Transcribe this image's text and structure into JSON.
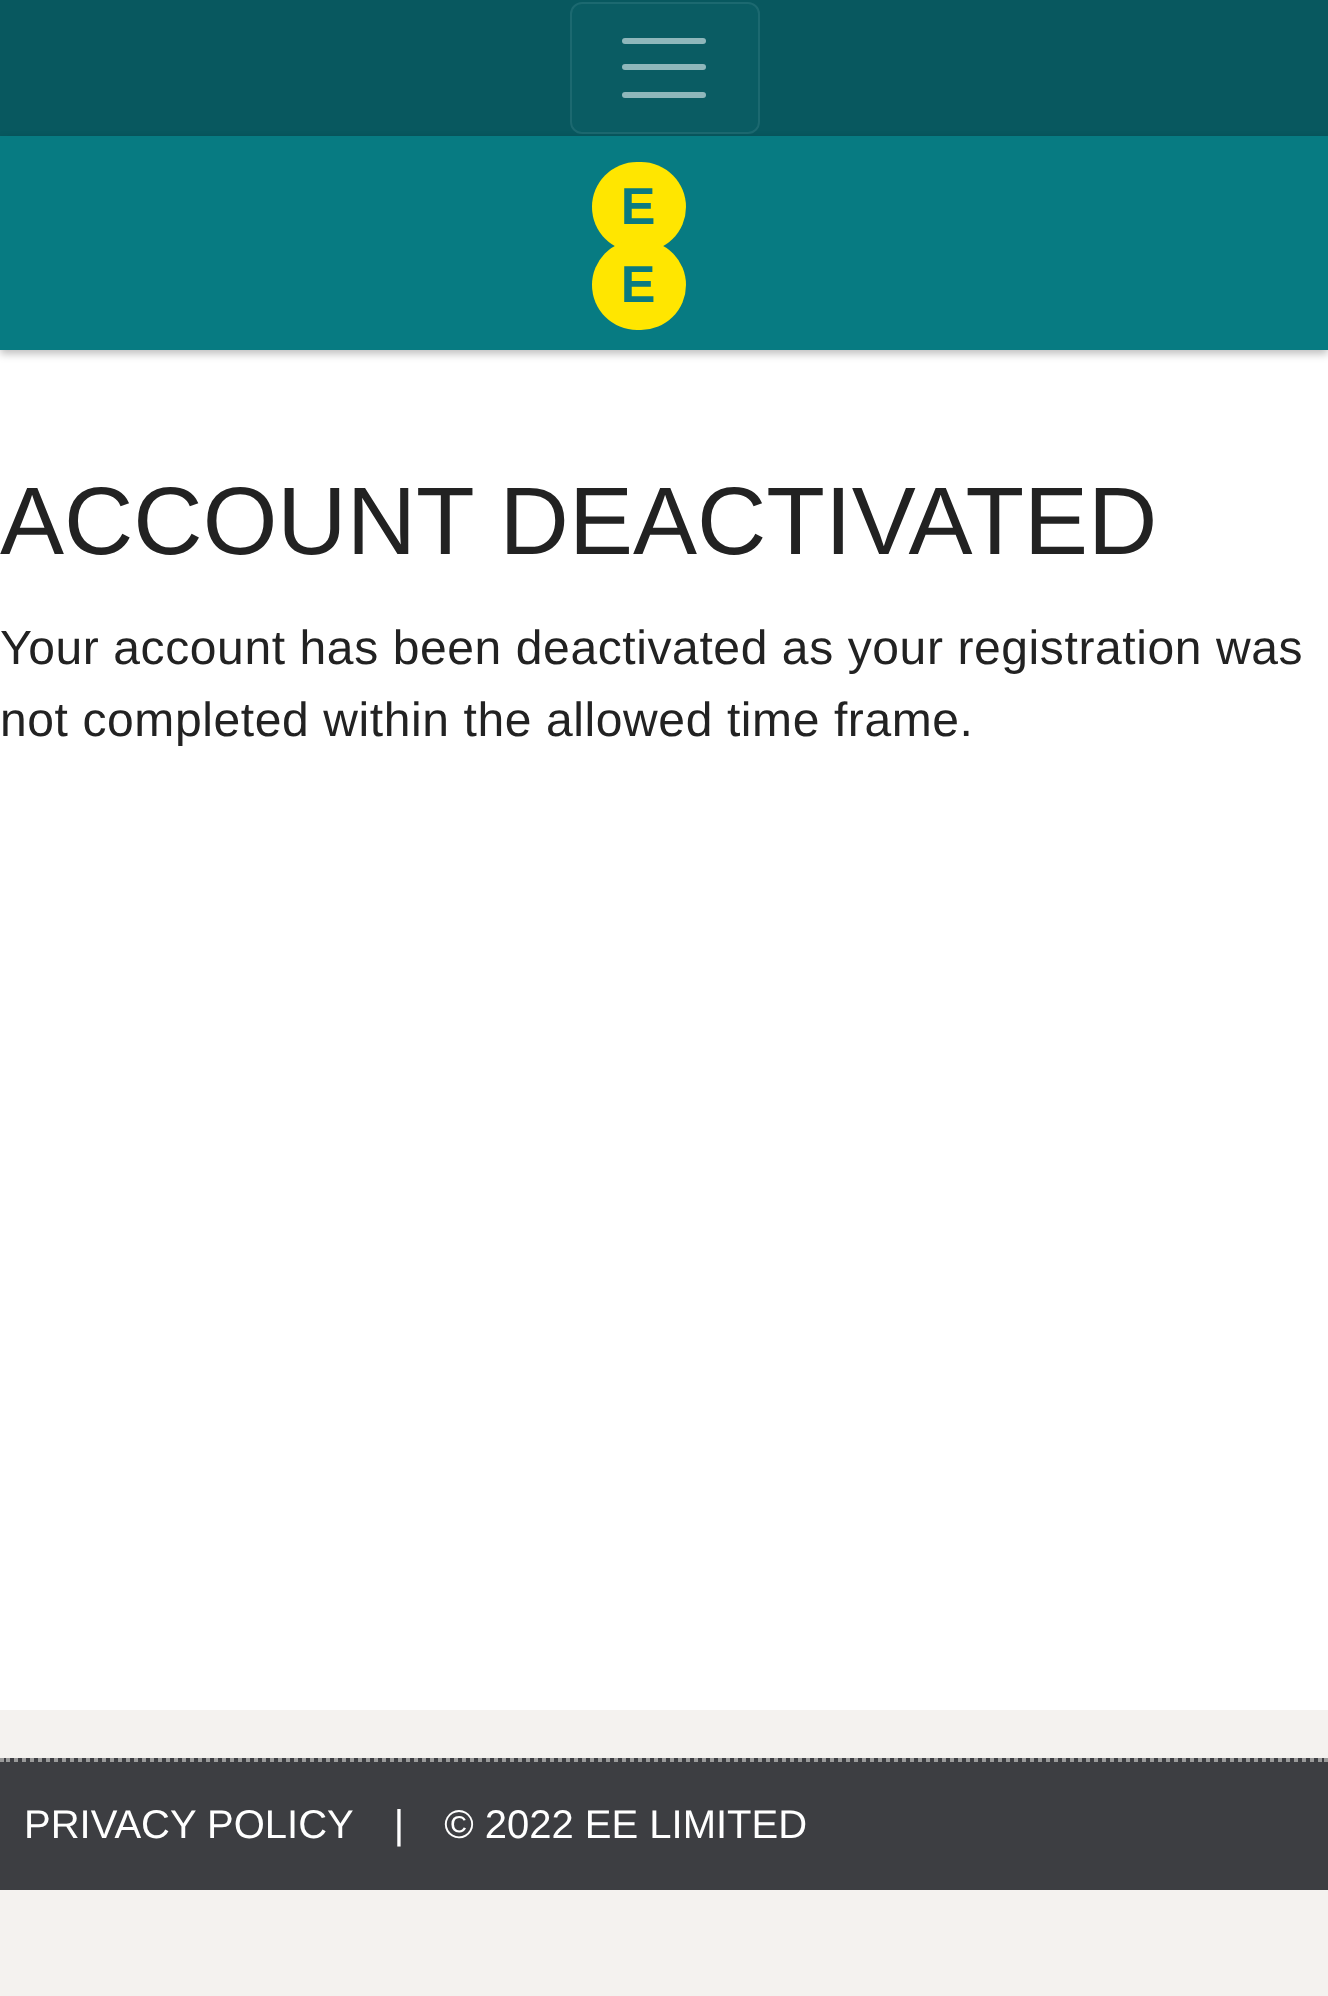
{
  "header": {
    "logo": {
      "letters": [
        "E",
        "E"
      ]
    }
  },
  "page": {
    "title": "ACCOUNT DEACTIVATED",
    "message": "Your account has been deactivated as your registration was not completed within the allowed time frame."
  },
  "footer": {
    "privacy_link": "PRIVACY POLICY",
    "separator": "|",
    "copyright": "© 2022 EE LIMITED"
  }
}
